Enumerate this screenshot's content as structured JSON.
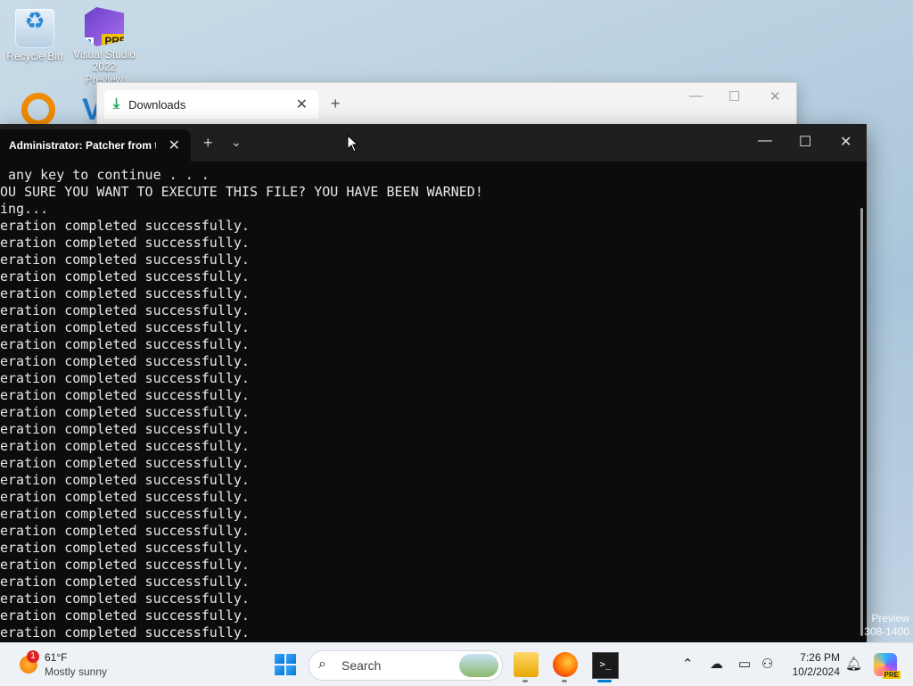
{
  "desktop": {
    "icons": [
      {
        "label": "Recycle Bin"
      },
      {
        "label": "Visual Studio 2022 Preview",
        "badge": "PRE"
      }
    ],
    "watermark": [
      "Preview",
      "308-1400"
    ]
  },
  "downloads_window": {
    "tab_title": "Downloads",
    "icons": {
      "download": "download-icon",
      "close": "close-icon",
      "new_tab": "plus-icon"
    }
  },
  "terminal": {
    "tab_title": "Administrator:  Patcher from t",
    "lines": [
      " any key to continue . . .",
      "OU SURE YOU WANT TO EXECUTE THIS FILE? YOU HAVE BEEN WARNED!",
      "ing...",
      "eration completed successfully.",
      "eration completed successfully.",
      "eration completed successfully.",
      "eration completed successfully.",
      "eration completed successfully.",
      "eration completed successfully.",
      "eration completed successfully.",
      "eration completed successfully.",
      "eration completed successfully.",
      "eration completed successfully.",
      "eration completed successfully.",
      "eration completed successfully.",
      "eration completed successfully.",
      "eration completed successfully.",
      "eration completed successfully.",
      "eration completed successfully.",
      "eration completed successfully.",
      "eration completed successfully.",
      "eration completed successfully.",
      "eration completed successfully.",
      "eration completed successfully.",
      "eration completed successfully.",
      "eration completed successfully.",
      "eration completed successfully.",
      "eration completed successfully."
    ]
  },
  "taskbar": {
    "weather": {
      "temp": "61°F",
      "condition": "Mostly sunny",
      "badge": "1"
    },
    "search_placeholder": "Search",
    "clock": {
      "time": "7:26 PM",
      "date": "10/2/2024"
    },
    "copilot_badge": "PRE"
  },
  "colors": {
    "terminal_bg": "#0c0c0c",
    "taskbar_bg": "#eef1f5",
    "accent": "#0078d4"
  }
}
